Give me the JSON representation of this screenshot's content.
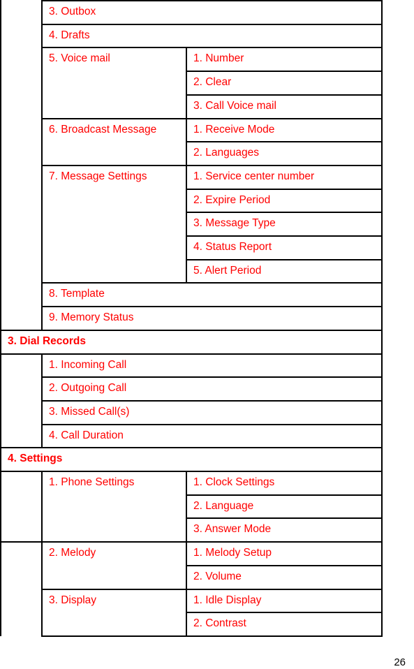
{
  "document": {
    "type": "phone menu tree table (continued)",
    "text_color": "#ff0000",
    "border_color": "#000000",
    "page_number": "26"
  },
  "rows": [
    {
      "level": 2,
      "label": "3. Outbox"
    },
    {
      "level": 2,
      "label": "4. Drafts"
    },
    {
      "level": 2,
      "label": "5. Voice mail",
      "children": [
        "1. Number",
        "2. Clear",
        "3. Call Voice mail"
      ]
    },
    {
      "level": 2,
      "label": "6. Broadcast Message",
      "children": [
        "1. Receive Mode",
        "2. Languages"
      ]
    },
    {
      "level": 2,
      "label": "7. Message Settings",
      "children": [
        "1. Service center number",
        "2. Expire Period",
        "3. Message Type",
        "4. Status Report",
        "5. Alert Period"
      ]
    },
    {
      "level": 2,
      "label": "8. Template"
    },
    {
      "level": 2,
      "label": "9. Memory Status"
    },
    {
      "level": 1,
      "label": "3. Dial Records"
    },
    {
      "level": 2,
      "label": "1. Incoming Call"
    },
    {
      "level": 2,
      "label": "2. Outgoing Call"
    },
    {
      "level": 2,
      "label": "3. Missed Call(s)"
    },
    {
      "level": 2,
      "label": "4. Call Duration"
    },
    {
      "level": 1,
      "label": "4. Settings"
    },
    {
      "level": 2,
      "label": "1. Phone Settings",
      "children": [
        "1. Clock Settings",
        "2. Language",
        "3. Answer Mode"
      ]
    },
    {
      "level": 2,
      "label": "2. Melody",
      "children": [
        "1. Melody Setup",
        "2. Volume"
      ]
    },
    {
      "level": 2,
      "label": "3. Display",
      "children": [
        "1. Idle Display",
        "2. Contrast"
      ]
    }
  ]
}
